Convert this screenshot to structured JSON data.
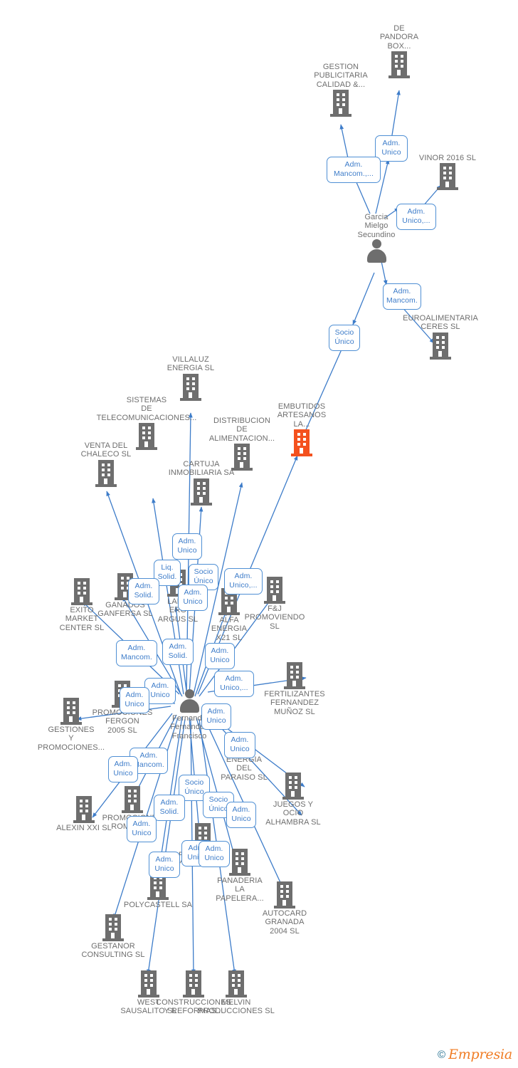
{
  "diagram": {
    "type": "corporate-network-graph",
    "title": "EMBUTIDOS ARTESANOS LA... corporate relations graph",
    "colors": {
      "company_icon": "#6e6e6e",
      "highlight_company_icon": "#f4511e",
      "edge": "#3d7cc9",
      "relation_border": "#4f8fd4",
      "relation_text": "#3d7cc9",
      "node_label": "#6e6e6e",
      "background": "#ffffff"
    },
    "watermark": {
      "copyright": "©",
      "brand": "Empresia"
    }
  },
  "nodes": [
    {
      "id": "pandora",
      "label": "DE\nPANDORA\nBOX...",
      "type": "company"
    },
    {
      "id": "gestion_pub",
      "label": "GESTION\nPUBLICITARIA\nCALIDAD &...",
      "type": "company"
    },
    {
      "id": "vinor",
      "label": "VINOR 2016  SL",
      "type": "company"
    },
    {
      "id": "garcia",
      "label": "Garcia\nMielgo\nSecundino",
      "type": "person"
    },
    {
      "id": "euroalim",
      "label": "EUROALIMENTARIA\nCERES  SL",
      "type": "company"
    },
    {
      "id": "embutidos",
      "label": "EMBUTIDOS\nARTESANOS\nLA...",
      "type": "company",
      "highlight": true
    },
    {
      "id": "villaluz",
      "label": "VILLALUZ\nENERGIA  SL",
      "type": "company"
    },
    {
      "id": "sistemas",
      "label": "SISTEMAS\nDE\nTELECOMUNICACIONES...",
      "type": "company"
    },
    {
      "id": "distribucion",
      "label": "DISTRIBUCION\nDE\nALIMENTACION...",
      "type": "company"
    },
    {
      "id": "venta",
      "label": "VENTA DEL\nCHALECO SL",
      "type": "company"
    },
    {
      "id": "cartuja",
      "label": "CARTUJA\nINMOBILIARIA SA",
      "type": "company"
    },
    {
      "id": "exito",
      "label": "EXITO\nMARKET\nCENTER  SL",
      "type": "company"
    },
    {
      "id": "ganados",
      "label": "GANADOS\nGANFERSA SL",
      "type": "company"
    },
    {
      "id": "labo",
      "label": "LABO\nERG\nARGUS SL",
      "type": "company"
    },
    {
      "id": "alfa",
      "label": "ALFA\nENERGIA\nX21  SL",
      "type": "company"
    },
    {
      "id": "fyj",
      "label": "F&J\nPROMOVIENDO\nSL",
      "type": "company"
    },
    {
      "id": "fertilizantes",
      "label": "FERTILIZANTES\nFERNANDEZ\nMUÑOZ  SL",
      "type": "company"
    },
    {
      "id": "gestiones",
      "label": "GESTIONES\nY\nPROMOCIONES...",
      "type": "company"
    },
    {
      "id": "fergon",
      "label": "PROMOCIONES\nFERGON\n2005 SL",
      "type": "company"
    },
    {
      "id": "fernandez",
      "label": "Fernando\nFernandez\nFrancisco",
      "type": "person"
    },
    {
      "id": "energia_par",
      "label": "ENERGIA\nDEL\nPARAISO  SL",
      "type": "company"
    },
    {
      "id": "juegos",
      "label": "JUEGOS Y\nOCIO\nALHAMBRA SL",
      "type": "company"
    },
    {
      "id": "alexin",
      "label": "ALEXIN XXI SL",
      "type": "company"
    },
    {
      "id": "promo_romero",
      "label": "PROMOCIONES\nROMERO...",
      "type": "company"
    },
    {
      "id": "fernandez_suarez",
      "label": "FERNANDEZ\nY SUAREZ SL",
      "type": "company"
    },
    {
      "id": "panaderia",
      "label": "PANADERIA\nLA\nPAPELERA...",
      "type": "company"
    },
    {
      "id": "polycastell",
      "label": "POLYCASTELL SA",
      "type": "company"
    },
    {
      "id": "autocard",
      "label": "AUTOCARD\nGRANADA\n2004 SL",
      "type": "company"
    },
    {
      "id": "gestanor",
      "label": "GESTANOR\nCONSULTING SL",
      "type": "company"
    },
    {
      "id": "west",
      "label": "WEST\nSAUSALITO SL",
      "type": "company"
    },
    {
      "id": "construcciones",
      "label": "CONSTRUCCIONES\nY REFORMAS...",
      "type": "company"
    },
    {
      "id": "melvin",
      "label": "MELVIN\nPRODUCCIONES SL",
      "type": "company"
    }
  ],
  "relations": [
    {
      "id": "r1",
      "label": "Adm.\nUnico"
    },
    {
      "id": "r2",
      "label": "Adm.\nMancom.,..."
    },
    {
      "id": "r3",
      "label": "Adm.\nUnico,..."
    },
    {
      "id": "r4",
      "label": "Adm.\nMancom."
    },
    {
      "id": "r5",
      "label": "Socio\nÚnico"
    },
    {
      "id": "r6",
      "label": "Adm.\nUnico"
    },
    {
      "id": "r7",
      "label": "Liq.\nSolid."
    },
    {
      "id": "r8",
      "label": "Socio\nÚnico"
    },
    {
      "id": "r9",
      "label": "Adm.\nUnico,..."
    },
    {
      "id": "r10",
      "label": "Adm.\nSolid."
    },
    {
      "id": "r11",
      "label": "Adm.\nUnico"
    },
    {
      "id": "r12",
      "label": "Adm.\nMancom."
    },
    {
      "id": "r13",
      "label": "Adm.\nSolid."
    },
    {
      "id": "r14",
      "label": "Adm.\nUnico"
    },
    {
      "id": "r15",
      "label": "Adm.\nUnico,..."
    },
    {
      "id": "r16",
      "label": "Adm.\nUnico"
    },
    {
      "id": "r17",
      "label": "Adm.\nUnico"
    },
    {
      "id": "r18",
      "label": "Adm.\nUnico"
    },
    {
      "id": "r19",
      "label": "Adm.\nUnico"
    },
    {
      "id": "r20",
      "label": "Adm.\nMancom."
    },
    {
      "id": "r21",
      "label": "Adm.\nUnico"
    },
    {
      "id": "r22",
      "label": "Socio\nÚnico"
    },
    {
      "id": "r23",
      "label": "Adm.\nSolid."
    },
    {
      "id": "r24",
      "label": "Socio\nÚnico"
    },
    {
      "id": "r25",
      "label": "Adm.\nUnico"
    },
    {
      "id": "r26",
      "label": "Adm.\nUnico"
    },
    {
      "id": "r27",
      "label": "Adm.\nUnico"
    },
    {
      "id": "r28",
      "label": "Adm.\nUnico"
    },
    {
      "id": "r29",
      "label": "Adm.\nUnico"
    }
  ]
}
